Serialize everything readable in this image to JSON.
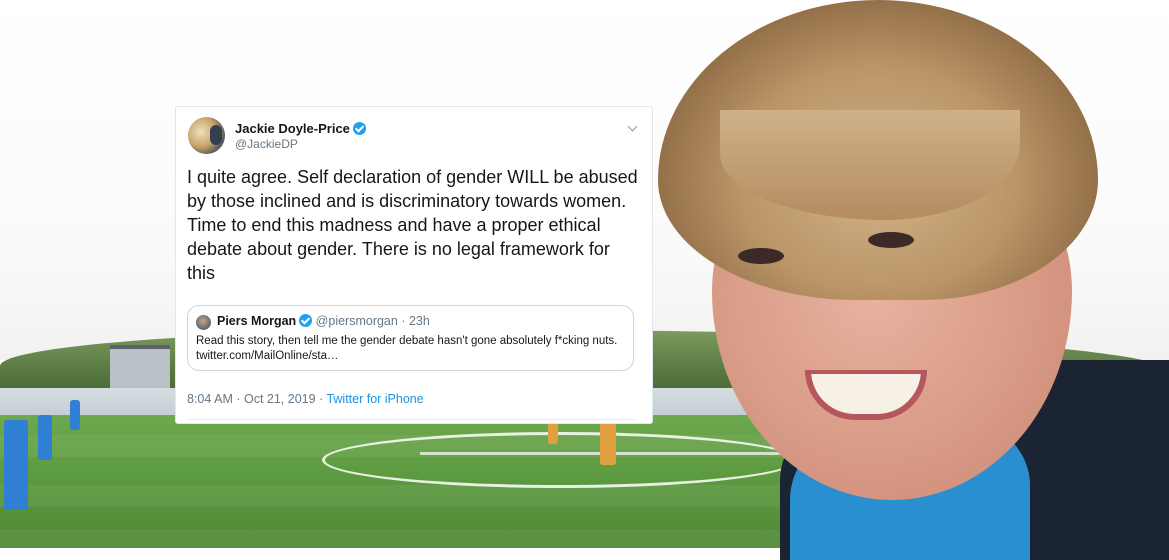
{
  "tweet": {
    "author_name": "Jackie Doyle-Price",
    "author_handle": "@JackieDP",
    "verified": true,
    "body": "I quite agree. Self declaration of gender WILL be abused by those inclined and is discriminatory towards women. Time to end this madness and have a proper ethical debate about gender. There is no legal framework for this",
    "timestamp": "8:04 AM · Oct 21, 2019",
    "separator": " · ",
    "source": "Twitter for iPhone",
    "quoted": {
      "author_name": "Piers Morgan",
      "author_handle": "@piersmorgan",
      "age": "· 23h",
      "verified": true,
      "text": "Read this story, then tell me the gender debate hasn't gone absolutely f*cking nuts. twitter.com/MailOnline/sta…"
    }
  },
  "icons": [
    "verified-badge-icon",
    "chevron-down-icon"
  ],
  "colors": {
    "link": "#1b95e0",
    "verified": "#1da1f2",
    "secondary_text": "#657786",
    "primary_text": "#14171a"
  }
}
